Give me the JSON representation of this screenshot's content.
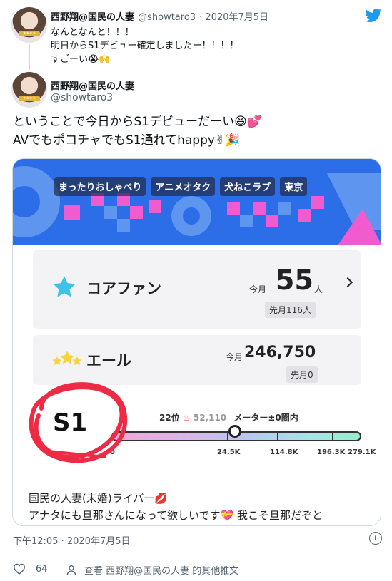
{
  "tweet1": {
    "name": "西野翔@国民の人妻",
    "handle": "@showtaro3",
    "date": "· 2020年7月5日",
    "text": "なんとなんと！！！\n明日からS1デビュー確定しましたー！！！！\nすごーい😭🙌"
  },
  "tweet2": {
    "name": "西野翔@国民の人妻",
    "handle": "@showtaro3",
    "text": "ということで今日からS1デビューだーい😆💕\nAVでもポコチャでもS1通れてhappy✌🎉"
  },
  "card": {
    "tags": [
      "まったりおしゃべり",
      "アニメオタク",
      "犬ねこラブ",
      "東京"
    ],
    "core_fan": {
      "title": "コアファン",
      "month_label": "今月",
      "value": "55",
      "unit": "人",
      "last_month": "先月116人"
    },
    "yell": {
      "title": "エール",
      "month_label": "今月",
      "value": "246,750",
      "last_month": "先月0"
    },
    "rank": {
      "position": "22位",
      "score": "52,110",
      "meter_text": "メーター±0圏内",
      "level": "S1",
      "meter_labels": [
        "0",
        "24.5K",
        "114.8K",
        "196.3K",
        "279.1K"
      ]
    },
    "bio": "国民の人妻(未婚)ライバー💋\nアナタにも旦那さんになって欲しいです💝 我こそ旦那だぞと"
  },
  "footer": {
    "timestamp": "下午12:05 · 2020年7月5日",
    "likes": "64",
    "more_tweets": "查看 西野翔@国民の人妻 的其他推文"
  },
  "colors": {
    "twitter_blue": "#1d9bf0",
    "banner_blue": "#2c6ee8",
    "banner_pink": "#f05bd0",
    "star_cyan": "#3bc4e8",
    "circle_red": "#ee2a44"
  }
}
